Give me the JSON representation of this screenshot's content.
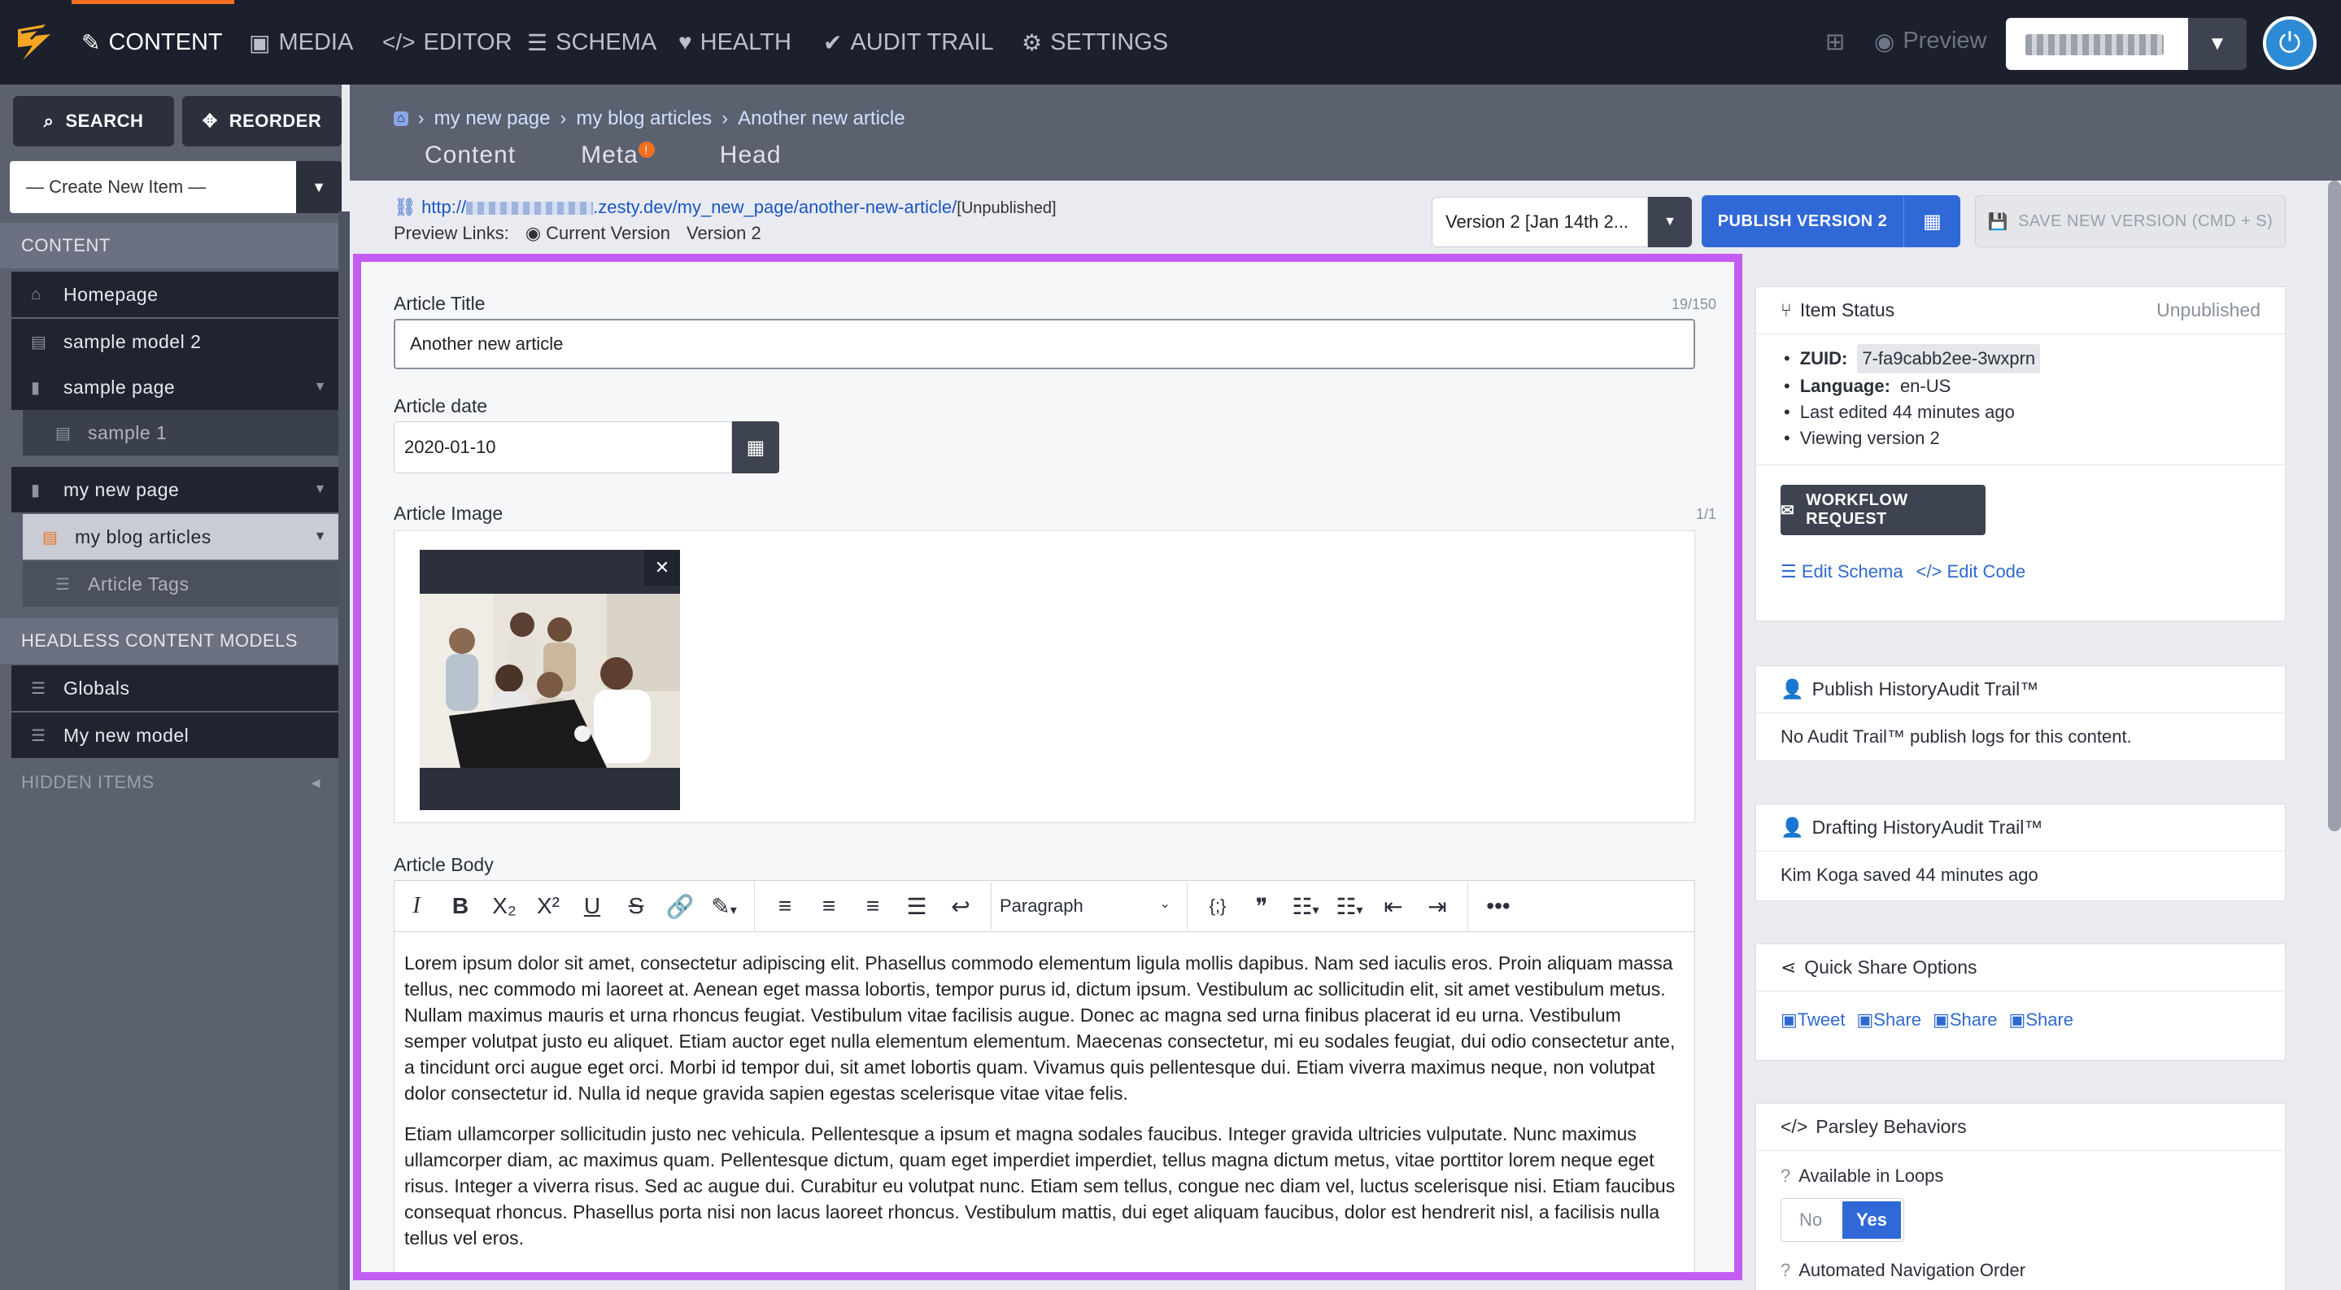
{
  "topnav": {
    "items": [
      {
        "label": "CONTENT",
        "icon": "edit-icon",
        "glyph": "✎"
      },
      {
        "label": "MEDIA",
        "icon": "image-icon",
        "glyph": "▣"
      },
      {
        "label": "EDITOR",
        "icon": "code-icon",
        "glyph": "</>"
      },
      {
        "label": "SCHEMA",
        "icon": "database-icon",
        "glyph": "☰"
      },
      {
        "label": "HEALTH",
        "icon": "heart-icon",
        "glyph": "♥"
      },
      {
        "label": "AUDIT TRAIL",
        "icon": "user-check-icon",
        "glyph": "✔"
      },
      {
        "label": "SETTINGS",
        "icon": "gear-icon",
        "glyph": "⚙"
      }
    ],
    "active": "CONTENT",
    "preview_label": "Preview",
    "accent": "#f37021"
  },
  "sidebar": {
    "search_label": "SEARCH",
    "reorder_label": "REORDER",
    "create_label": "— Create New Item —",
    "content_header": "CONTENT",
    "items": [
      {
        "label": "Homepage",
        "icon": "home-icon"
      },
      {
        "label": "sample model 2",
        "icon": "list-icon"
      },
      {
        "label": "sample page",
        "icon": "file-icon"
      },
      {
        "label": "sample 1",
        "icon": "list-icon"
      },
      {
        "label": "my new page",
        "icon": "file-icon"
      },
      {
        "label": "my blog articles",
        "icon": "list-icon"
      },
      {
        "label": "Article Tags",
        "icon": "database-icon"
      }
    ],
    "headless_header": "HEADLESS CONTENT MODELS",
    "headless_items": [
      {
        "label": "Globals",
        "icon": "database-icon"
      },
      {
        "label": "My new model",
        "icon": "database-icon"
      }
    ],
    "hidden_header": "HIDDEN ITEMS"
  },
  "header": {
    "breadcrumbs": [
      "my new page",
      "my blog articles",
      "Another new article"
    ],
    "tabs": [
      "Content",
      "Meta",
      "Head"
    ],
    "meta_badge": "!"
  },
  "urlbar": {
    "url_prefix": "http://",
    "url_domain": ".zesty.dev/my_new_page/another-new-article/",
    "status": "[Unpublished]",
    "preview_links_label": "Preview Links:",
    "current_version": "Current Version",
    "version_link": "Version 2"
  },
  "versionbar": {
    "version_select": "Version 2 [Jan 14th 2...",
    "publish_label": "PUBLISH VERSION 2",
    "save_label": "SAVE NEW VERSION (CMD + S)"
  },
  "form": {
    "title_label": "Article Title",
    "title_count": "19/150",
    "title_value": "Another new article",
    "date_label": "Article date",
    "date_value": "2020-01-10",
    "image_label": "Article Image",
    "image_count": "1/1",
    "body_label": "Article Body",
    "format_select": "Paragraph",
    "body_paragraphs": [
      "Lorem ipsum dolor sit amet, consectetur adipiscing elit. Phasellus commodo elementum ligula mollis dapibus. Nam sed iaculis eros. Proin aliquam massa tellus, nec commodo mi laoreet at. Aenean eget massa lobortis, tempor purus id, dictum ipsum. Vestibulum ac sollicitudin elit, sit amet vestibulum metus. Nullam maximus mauris et urna rhoncus feugiat. Vestibulum vitae facilisis augue. Donec ac magna sed urna finibus placerat id eu urna. Vestibulum semper volutpat justo eu aliquet. Etiam auctor eget nulla elementum elementum. Maecenas consectetur, mi eu sodales feugiat, dui odio consectetur ante, a tincidunt orci augue eget orci. Morbi id tempor dui, sit amet lobortis quam. Vivamus quis pellentesque dui. Etiam viverra maximus neque, non volutpat dolor consectetur id. Nulla id neque gravida sapien egestas scelerisque vitae vitae felis.",
      "Etiam ullamcorper sollicitudin justo nec vehicula. Pellentesque a ipsum et magna sodales faucibus. Integer gravida ultricies vulputate. Nunc maximus ullamcorper diam, ac maximus quam. Pellentesque dictum, quam eget imperdiet imperdiet, tellus magna dictum metus, vitae porttitor lorem neque eget risus. Integer a viverra risus. Sed ac augue dui. Curabitur eu volutpat nunc. Etiam sem tellus, congue nec diam vel, luctus scelerisque nisi. Etiam faucibus consequat rhoncus. Phasellus porta nisi non lacus laoreet rhoncus. Vestibulum mattis, dui eget aliquam faucibus, dolor est hendrerit nisl, a facilisis nulla tellus vel eros."
    ],
    "panel_highlight": "#c45ef2"
  },
  "status_card": {
    "title": "Item Status",
    "state": "Unpublished",
    "zuid_label": "ZUID:",
    "zuid_value": "7-fa9cabb2ee-3wxprn",
    "language_label": "Language:",
    "language_value": "en-US",
    "last_edited": "Last edited 44 minutes ago",
    "viewing": "Viewing version 2",
    "workflow_label": "WORKFLOW REQUEST",
    "edit_schema": "Edit Schema",
    "edit_code": "Edit Code"
  },
  "publish_history": {
    "title": "Publish HistoryAudit Trail™",
    "body": "No Audit Trail™ publish logs for this content."
  },
  "drafting_history": {
    "title": "Drafting HistoryAudit Trail™",
    "body": "Kim Koga saved 44 minutes ago"
  },
  "quick_share": {
    "title": "Quick Share Options",
    "links": [
      "Tweet",
      "Share",
      "Share",
      "Share"
    ]
  },
  "parsley": {
    "title": "Parsley Behaviors",
    "loops_label": "Available in Loops",
    "no_label": "No",
    "yes_label": "Yes",
    "nav_order_label": "Automated Navigation Order"
  }
}
